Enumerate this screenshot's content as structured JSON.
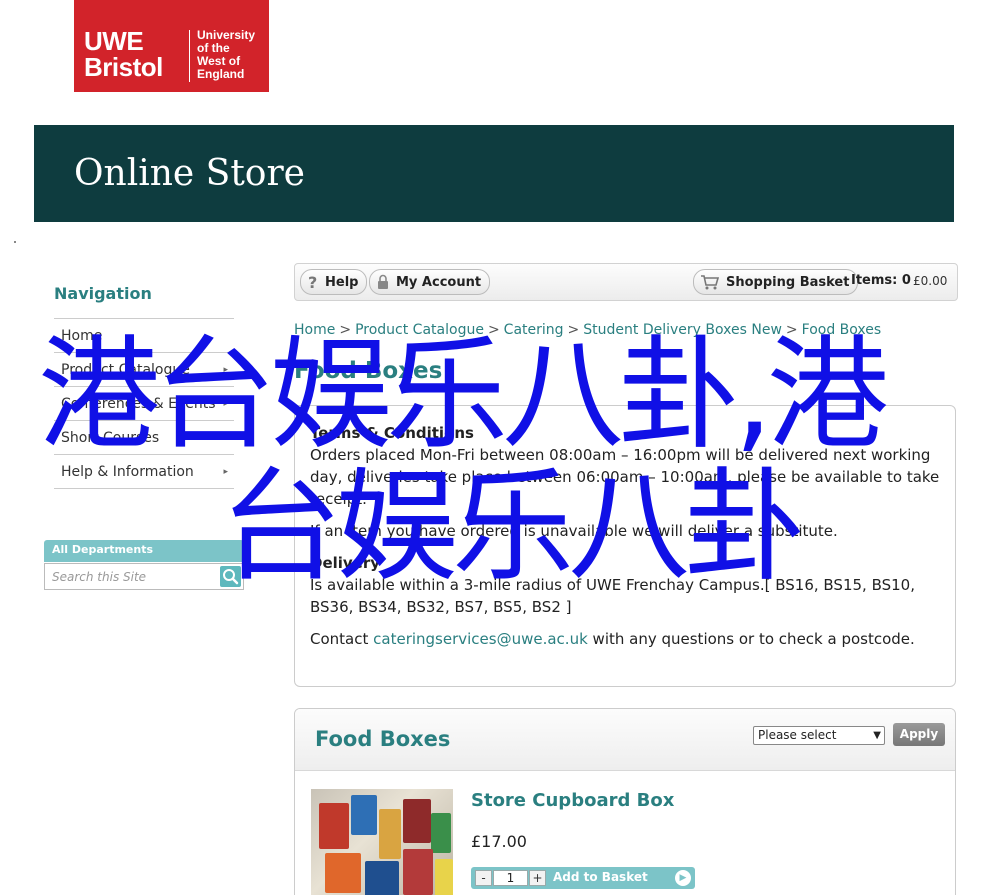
{
  "logo": {
    "short": "UWE Bristol",
    "short_line1": "UWE",
    "short_line2": "Bristol",
    "line1": "University",
    "line2": "of the",
    "line3": "West of",
    "line4": "England",
    "color": "#d2232a"
  },
  "banner": {
    "title": "Online Store",
    "color": "#0e3c3f"
  },
  "sidebar": {
    "title": "Navigation",
    "items": [
      {
        "label": "Home",
        "has_arrow": false
      },
      {
        "label": "Product Catalogue",
        "has_arrow": true
      },
      {
        "label": "Conferences & Events",
        "has_arrow": true
      },
      {
        "label": "Short Courses",
        "has_arrow": true
      },
      {
        "label": "Help & Information",
        "has_arrow": true
      }
    ],
    "departments_label": "All Departments",
    "search_placeholder": "Search this Site"
  },
  "toolbar": {
    "help_label": "Help",
    "account_label": "My Account",
    "basket_label": "Shopping Basket",
    "items_label": "Items:",
    "items_count": "0",
    "items_price": "£0.00"
  },
  "breadcrumb": [
    "Home",
    "Product Catalogue",
    "Catering",
    "Student Delivery Boxes New",
    "Food Boxes"
  ],
  "breadcrumb_sep": ">",
  "page_title": "Food Boxes",
  "info": {
    "terms_heading": "Terms & Conditions",
    "terms_text": "Orders placed Mon-Fri between 08:00am – 16:00pm will be delivered next working day, deliveries take place between 06:00am – 10:00am, please be available to take receipt.",
    "substitute_text": "If an item you have ordered is unavailable we will deliver a substitute.",
    "delivery_heading": "Delivery",
    "delivery_text": "Is available within a 3-mile radius of UWE Frenchay Campus.[ BS16, BS15, BS10, BS36, BS34, BS32, BS7, BS5, BS2 ]",
    "contact_prefix": "Contact ",
    "contact_email": "cateringservices@uwe.ac.uk",
    "contact_suffix": " with any questions or to check a postcode."
  },
  "products_panel": {
    "title": "Food Boxes",
    "select_value": "Please select",
    "apply_label": "Apply"
  },
  "product": {
    "name": "Store Cupboard Box",
    "price": "£17.00",
    "qty_minus": "-",
    "qty": "1",
    "qty_plus": "+",
    "add_label": "Add to Basket"
  },
  "overlay": {
    "line1": "港台娱乐八卦,港",
    "line2": "台娱乐八卦",
    "color": "#1010e6"
  },
  "accent_color": "#2a7f80"
}
